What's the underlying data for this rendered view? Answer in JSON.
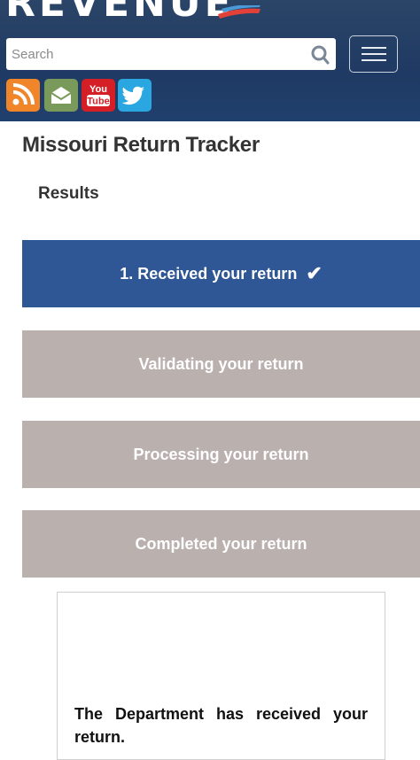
{
  "header": {
    "logo_text": "REVENUE",
    "search": {
      "placeholder": "Search",
      "value": ""
    },
    "social": [
      {
        "icon": "rss-icon"
      },
      {
        "icon": "email-icon"
      },
      {
        "icon": "youtube-icon",
        "text_top": "You",
        "text_bottom": "Tube"
      },
      {
        "icon": "twitter-icon"
      }
    ],
    "colors": {
      "background": "#1f3a63",
      "accent": "#e2413a"
    }
  },
  "page": {
    "title": "Missouri Return Tracker",
    "results_label": "Results"
  },
  "steps": [
    {
      "label": "1. Received your return",
      "status": "complete",
      "check": "✔"
    },
    {
      "label": "Validating your return",
      "status": "pending"
    },
    {
      "label": "Processing your return",
      "status": "pending"
    },
    {
      "label": "Completed your return",
      "status": "pending"
    }
  ],
  "step_colors": {
    "complete": "#2f5795",
    "pending": "#bab0ae"
  },
  "message": "The Department has received your return."
}
